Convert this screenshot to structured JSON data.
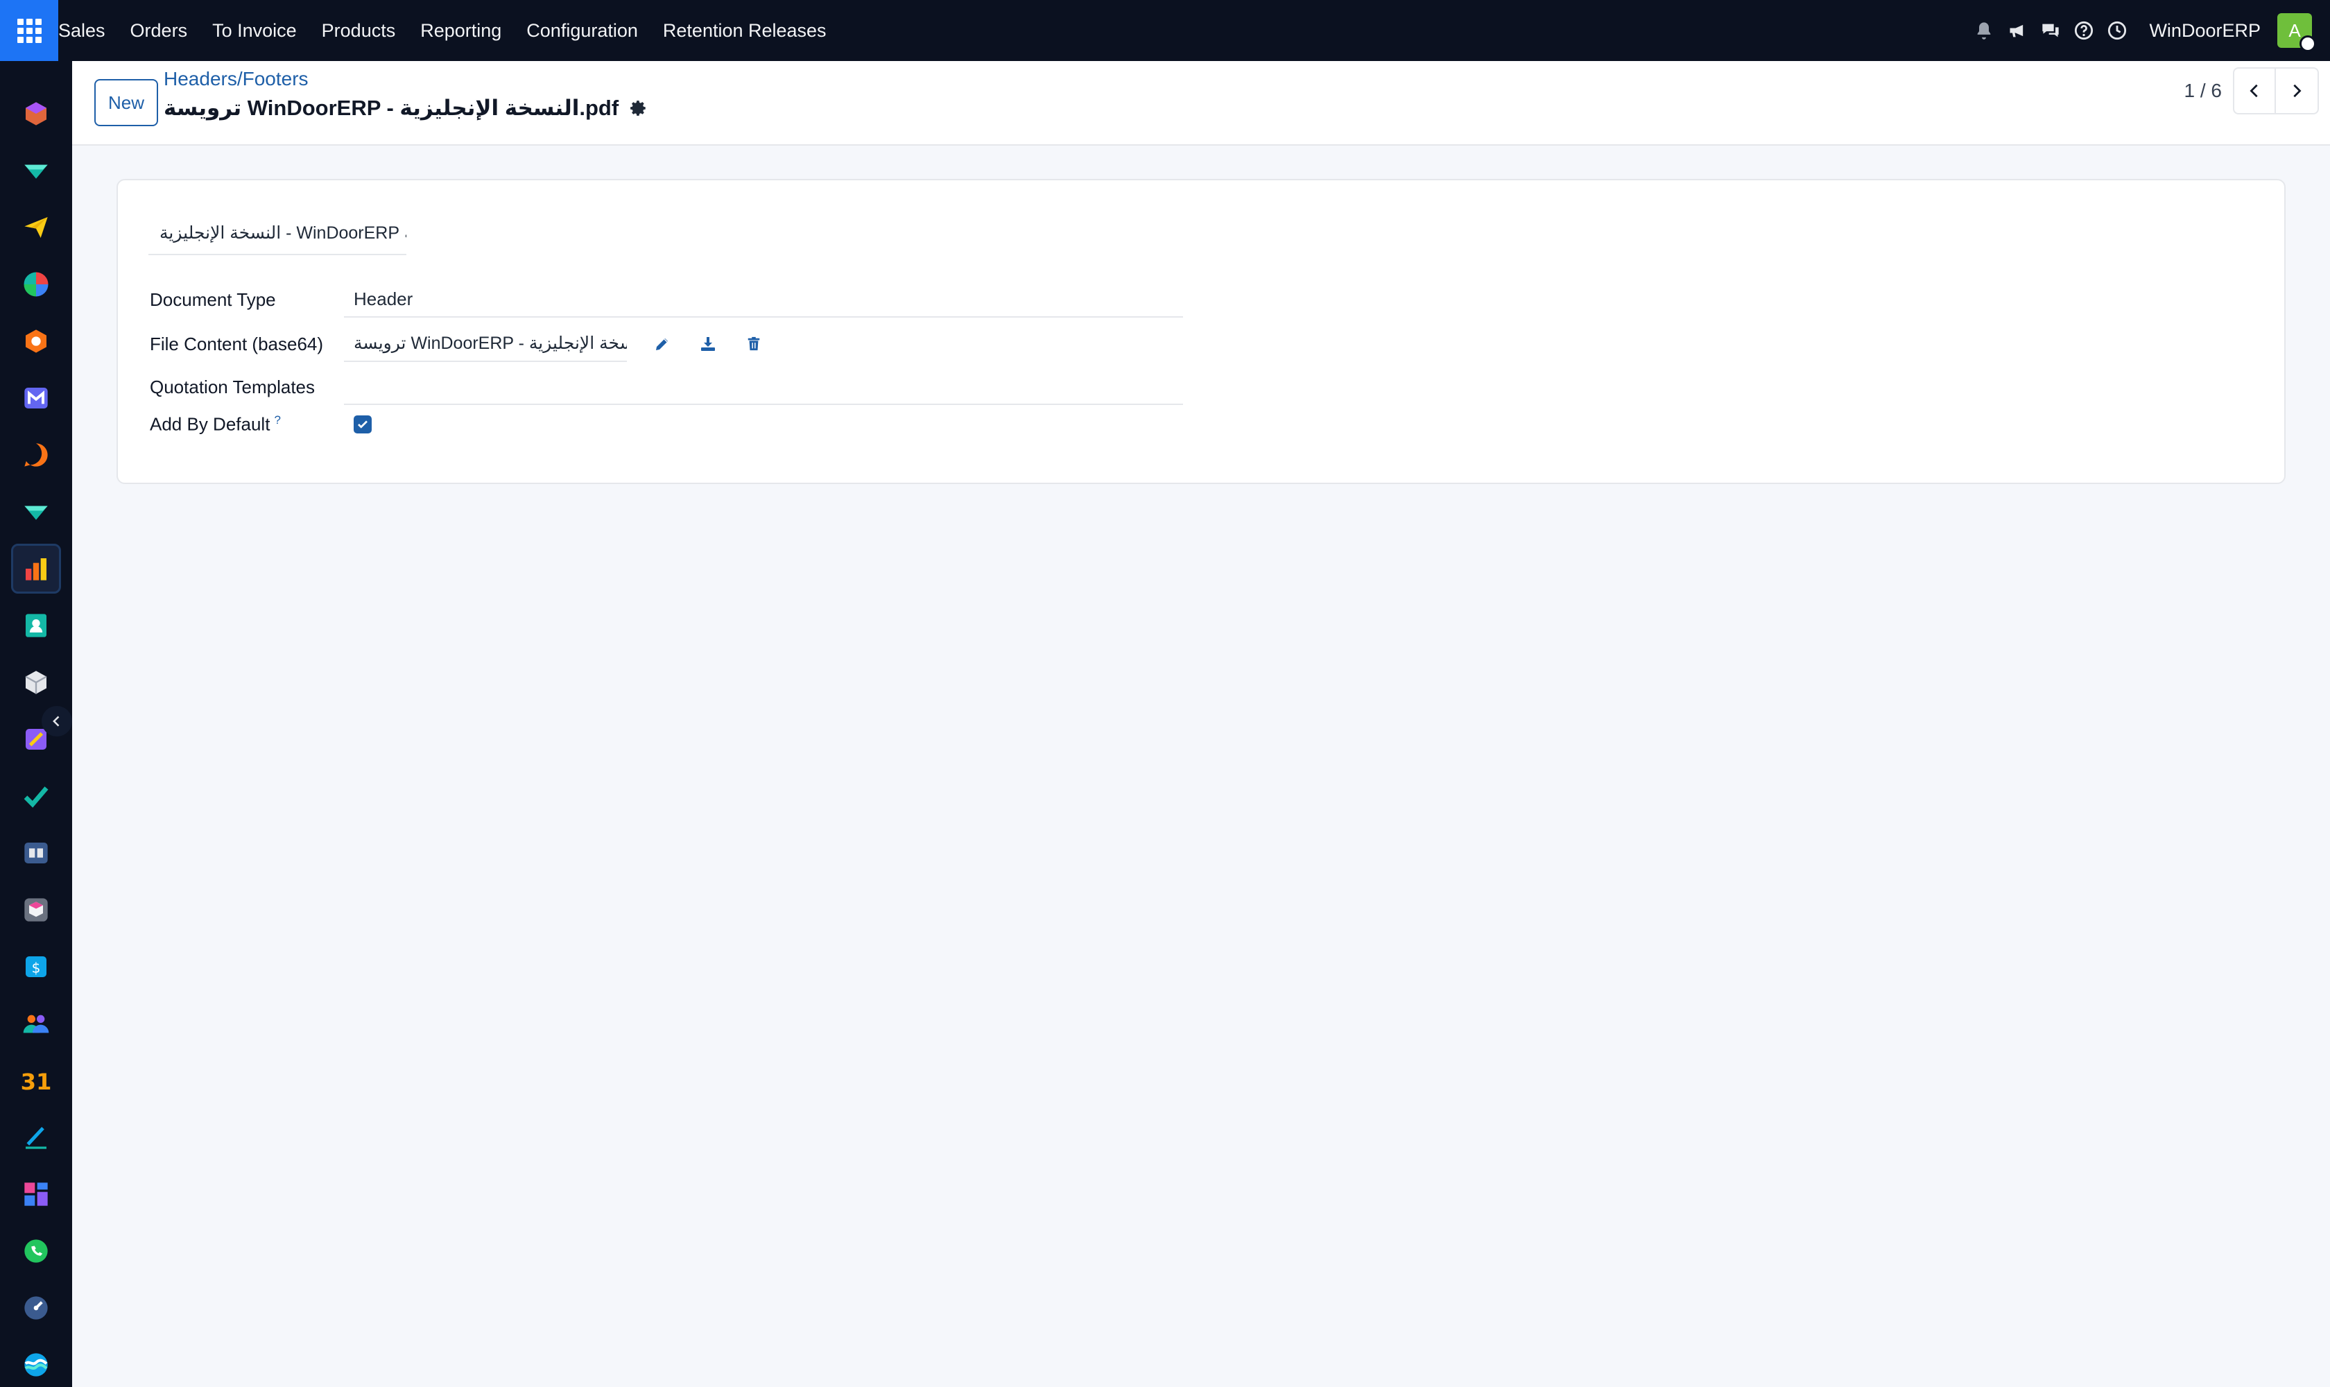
{
  "topbar": {
    "menu": [
      "Sales",
      "Orders",
      "To Invoice",
      "Products",
      "Reporting",
      "Configuration",
      "Retention Releases"
    ],
    "icons": [
      "bell-icon",
      "megaphone-icon",
      "chat-icon",
      "help-icon",
      "clock-icon"
    ],
    "company": "WinDoorERP",
    "avatar_initial": "A",
    "accent": "#1d74f5"
  },
  "control_panel": {
    "new_button": "New",
    "breadcrumb": "Headers/Footers",
    "title": "ترويسة WinDoorERP - النسخة الإنجليزية.pdf",
    "pager": "1 / 6"
  },
  "form": {
    "name_value": "ترويسة WinDoorERP - النسخة الإنجليزية",
    "document_type_label": "Document Type",
    "document_type_value": "Header",
    "file_content_label": "File Content (base64)",
    "file_content_value": "ترويسة WinDoorERP - النسخة الإنجليزية",
    "quotation_templates_label": "Quotation Templates",
    "quotation_templates_value": "",
    "add_by_default_label": "Add By Default",
    "add_by_default_help": "?",
    "add_by_default_checked": true
  }
}
